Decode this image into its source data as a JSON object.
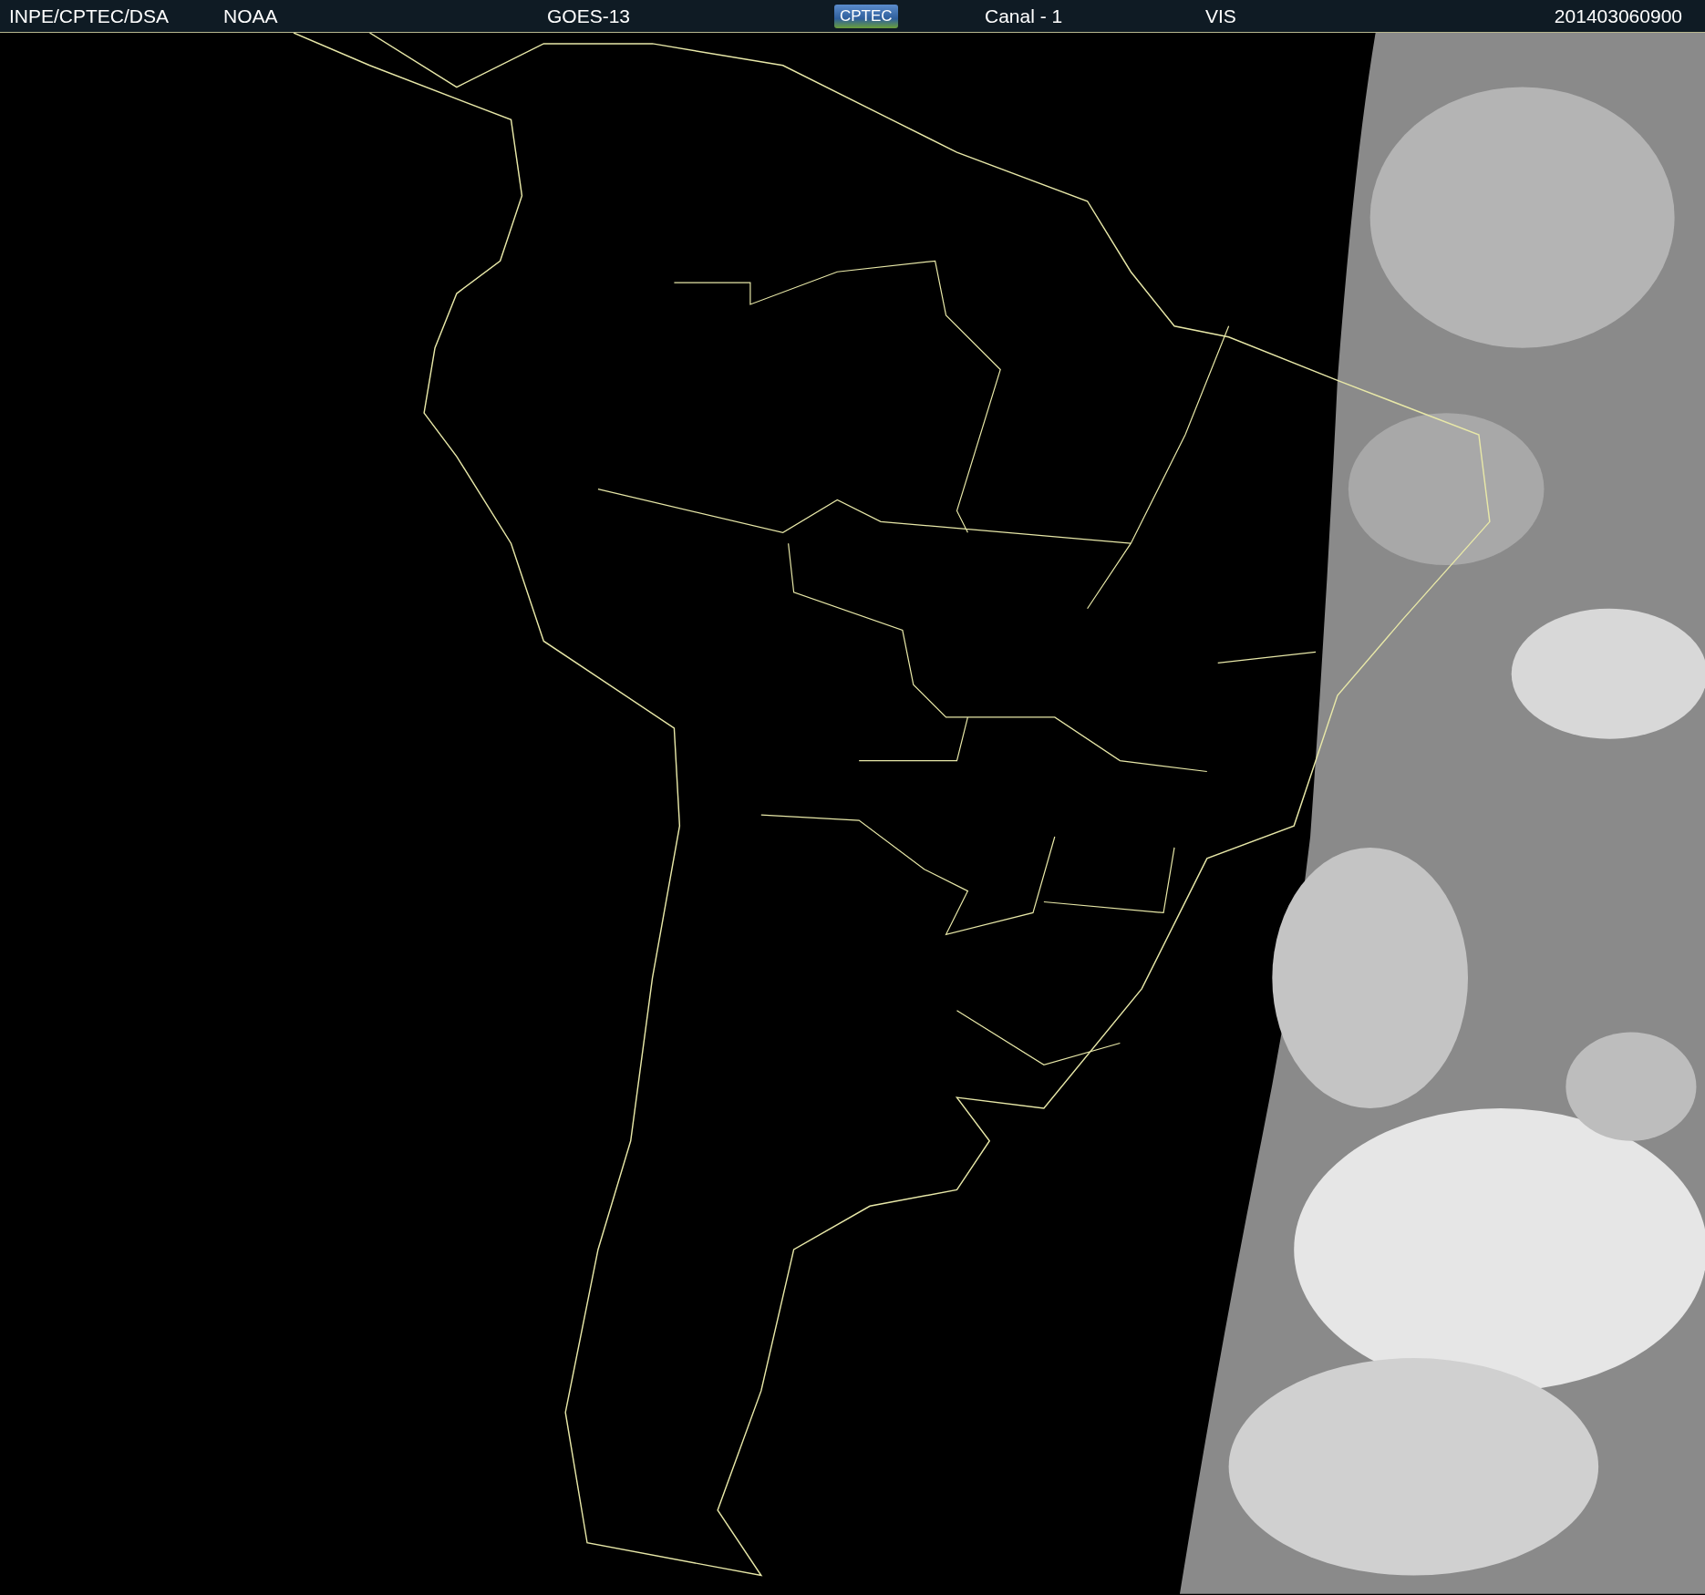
{
  "header": {
    "items": [
      {
        "kind": "text",
        "text": "INPE/CPTEC/DSA"
      },
      {
        "kind": "text",
        "text": "NOAA"
      },
      {
        "kind": "text",
        "text": "GOES-13"
      },
      {
        "kind": "logo",
        "text": "CPTEC"
      },
      {
        "kind": "text",
        "text": "Canal - 1"
      },
      {
        "kind": "text",
        "text": "VIS"
      },
      {
        "kind": "timestamp",
        "text": "201403060900"
      }
    ]
  }
}
